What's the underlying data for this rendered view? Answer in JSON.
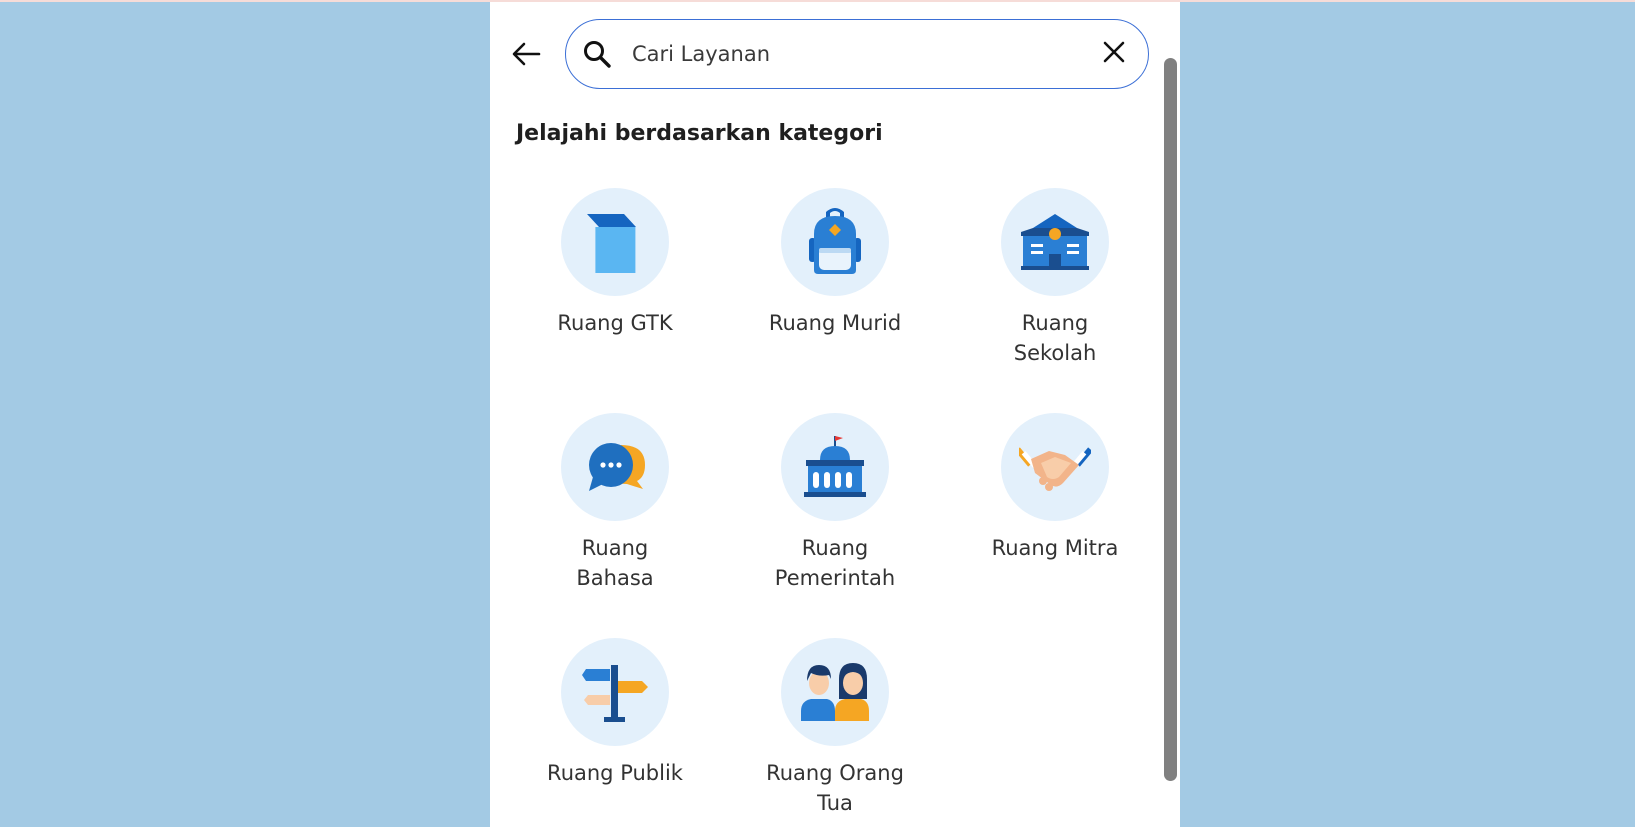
{
  "search": {
    "placeholder": "Cari Layanan"
  },
  "heading": "Jelajahi berdasarkan kategori",
  "categories": [
    {
      "label": "Ruang GTK",
      "icon": "book-icon"
    },
    {
      "label": "Ruang Murid",
      "icon": "backpack-icon"
    },
    {
      "label": "Ruang Sekolah",
      "icon": "school-building-icon"
    },
    {
      "label": "Ruang Bahasa",
      "icon": "chat-bubbles-icon"
    },
    {
      "label": "Ruang Pemerintah",
      "icon": "government-building-icon"
    },
    {
      "label": "Ruang Mitra",
      "icon": "handshake-icon"
    },
    {
      "label": "Ruang Publik",
      "icon": "signpost-icon"
    },
    {
      "label": "Ruang Orang Tua",
      "icon": "parents-icon"
    }
  ],
  "colors": {
    "accent": "#3b6fd6",
    "background": "#a3cae4",
    "icon_circle": "#e3f0fb"
  }
}
